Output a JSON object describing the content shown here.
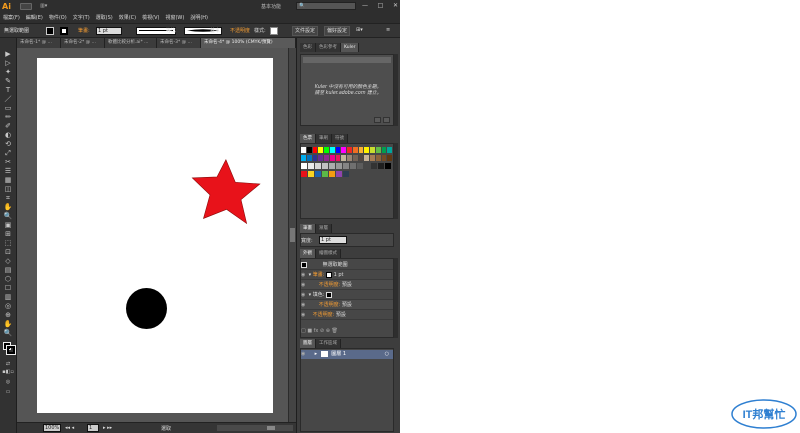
{
  "app": {
    "logo": "Ai",
    "workspace": "基本功能",
    "search_placeholder": "",
    "window_buttons": [
      "—",
      "□",
      "✕"
    ]
  },
  "menu": [
    "檔案(F)",
    "編輯(E)",
    "物件(O)",
    "文字(T)",
    "選取(S)",
    "效果(C)",
    "檢視(V)",
    "視窗(W)",
    "說明(H)"
  ],
  "control_bar": {
    "selection_label": "無選取範圍",
    "stroke_label": "筆畫:",
    "stroke_weight": "1 pt",
    "uniform_label": "等比",
    "basic_label": "基本",
    "opacity_label": "不透明度",
    "style_label": "樣式:",
    "doc_setup_button": "文件設定",
    "preferences_button": "偏好設定"
  },
  "doc_tabs": [
    "未命名-1* @ ...",
    "未命名-2* @ ...",
    "軟體比較分析.ai* ...",
    "未命名-3* @ ...",
    "未命名-4* @ 100% (CMYK/預覽)"
  ],
  "status_bar": {
    "zoom": "100%",
    "artboard": "1",
    "tool_name": "選取"
  },
  "panels": {
    "top_tabs": [
      "色彩",
      "色彩參考",
      "Kuler"
    ],
    "kuler_message": "Kuler 中沒有可用的顏色主題。\n請至 kuler.adobe.com 建立。",
    "swatch_tabs": [
      "色票",
      "筆刷",
      "符號"
    ],
    "stroke_tabs": [
      "筆畫",
      "漸層"
    ],
    "stroke_weight_label": "寬度:",
    "stroke_weight_value": "1 pt",
    "appearance_tabs": [
      "外觀",
      "繪圖樣式"
    ],
    "appearance_title": "無選取範圍",
    "appearance_rows": [
      {
        "label": "筆畫:",
        "value": "1 pt"
      },
      {
        "label": "不透明度:",
        "value": "預設"
      },
      {
        "label": "填色:",
        "value": ""
      },
      {
        "label": "不透明度:",
        "value": "預設"
      },
      {
        "label": "不透明度:",
        "value": "預設"
      }
    ],
    "layers_tabs": [
      "圖層",
      "工作區域"
    ],
    "layer_name": "圖層 1"
  },
  "artwork": {
    "star_color": "#e8121a",
    "circle_color": "#000000"
  },
  "watermark": {
    "text": "IT邦幫忙",
    "color": "#2e7fd1"
  },
  "swatch_colors": [
    [
      "#ffffff",
      "#000000",
      "#ff0000",
      "#ffff00",
      "#00ff00",
      "#00ffff",
      "#0000ff",
      "#ff00ff",
      "#ee2a24",
      "#f06e23",
      "#f8b133",
      "#fff200",
      "#c9de2f",
      "#63bb47",
      "#009f4f",
      "#00a69c"
    ],
    [
      "#00aeef",
      "#0072bc",
      "#2e3192",
      "#662d91",
      "#92278f",
      "#ec008c",
      "#ed145b",
      "#c2b59b",
      "#998675",
      "#736357",
      "#534741",
      "#c7b299",
      "#a67c52",
      "#8c6239",
      "#754c24",
      "#603913"
    ],
    [
      "#ffffff",
      "#ebebeb",
      "#d6d6d6",
      "#c2c2c2",
      "#adadad",
      "#999999",
      "#858585",
      "#707070",
      "#5c5c5c",
      "#474747",
      "#333333",
      "#1f1f1f",
      "#000000"
    ],
    [
      "#e8121a",
      "#f9d423",
      "#1e63b0",
      "#5bb947",
      "#f39c12",
      "#8e44ad",
      "#2c3e50"
    ]
  ],
  "tools": [
    "▶",
    "▷",
    "✦",
    "✎",
    "T",
    "／",
    "▭",
    "✏",
    "✐",
    "◐",
    "⟲",
    "⤢",
    "✂",
    "☰",
    "▦",
    "◫",
    "⌗",
    "✋",
    "🔍",
    "▣",
    "⊞",
    "⬚",
    "⊡",
    "◇",
    "▤",
    "⬡",
    "☐",
    "▥",
    "◎",
    "⊕",
    "⊖",
    "◉",
    "✋",
    "🔍"
  ]
}
